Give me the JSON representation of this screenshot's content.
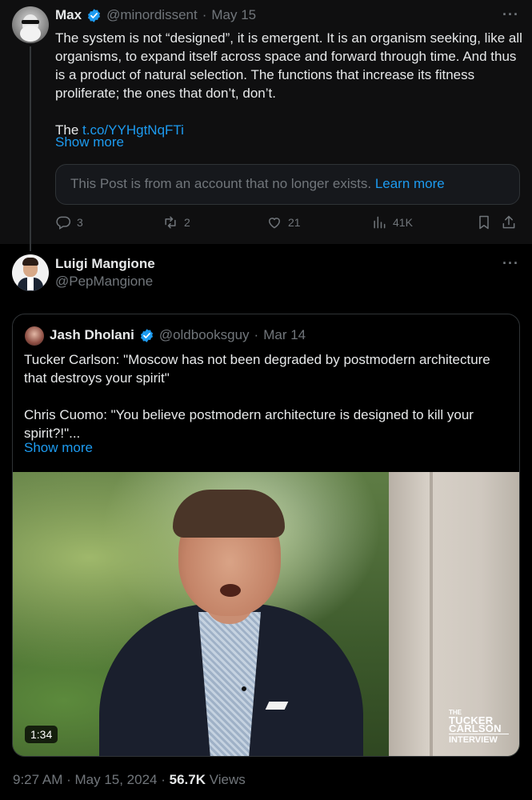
{
  "tweet1": {
    "name": "Max",
    "handle": "@minordissent",
    "sep": "·",
    "date": "May 15",
    "more": "···",
    "body": "The system is not “designed”, it is emergent. It is an organism seeking, like all organisms, to expand itself across space and forward through time. And thus is a product of natural selection. The functions that increase its fitness proliferate; the ones that don’t, don’t.",
    "body_prefix": "The ",
    "link": "t.co/YYHgtNqFTi",
    "show_more": "Show more",
    "notice_text": "This Post is from an account that no longer exists.",
    "notice_link": "Learn more",
    "actions": {
      "replies": "3",
      "reposts": "2",
      "likes": "21",
      "views": "41K"
    }
  },
  "tweet2": {
    "name": "Luigi Mangione",
    "handle": "@PepMangione",
    "more": "···",
    "quote": {
      "name": "Jash Dholani",
      "handle": "@oldbooksguy",
      "sep": "·",
      "date": "Mar 14",
      "line1": "Tucker Carlson: \"Moscow has not been degraded by postmodern architecture that destroys your spirit\"",
      "line2": "Chris Cuomo: \"You believe postmodern architecture is designed to kill your spirit?!\"...",
      "show_more": "Show more",
      "video_duration": "1:34",
      "video_logo": [
        "THE",
        "TUCKER",
        "CARLSON",
        "INTERVIEW"
      ]
    },
    "timestamp": "9:27 AM · May 15, 2024 · ",
    "views_count": "56.7K",
    "views_label": " Views"
  },
  "colors": {
    "accent": "#1d9bf0",
    "muted": "#71767b",
    "text": "#e7e9ea",
    "background": "#000000"
  },
  "icons": [
    "verified-icon",
    "reply-icon",
    "repost-icon",
    "like-icon",
    "views-icon",
    "bookmark-icon",
    "share-icon"
  ]
}
